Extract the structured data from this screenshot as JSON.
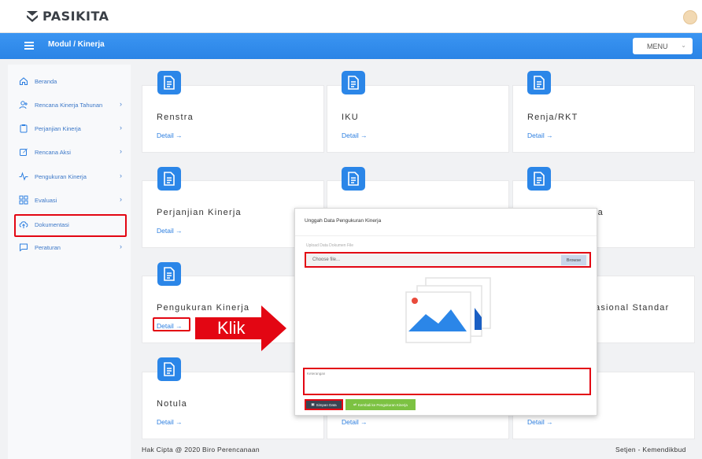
{
  "app": {
    "name": "PASIKITA"
  },
  "header": {
    "breadcrumb": "Modul / Kinerja",
    "menu_label": "MENU"
  },
  "sidebar": {
    "items": [
      {
        "label": "Beranda",
        "icon": "home-icon"
      },
      {
        "label": "Rencana Kinerja Tahunan",
        "icon": "user-plus-icon"
      },
      {
        "label": "Perjanjian Kinerja",
        "icon": "clipboard-icon"
      },
      {
        "label": "Rencana Aksi",
        "icon": "edit-icon"
      },
      {
        "label": "Pengukuran Kinerja",
        "icon": "activity-icon"
      },
      {
        "label": "Evaluasi",
        "icon": "grid-icon"
      },
      {
        "label": "Dokumentasi",
        "icon": "cloud-upload-icon"
      },
      {
        "label": "Peraturan",
        "icon": "message-icon"
      }
    ]
  },
  "cards": [
    {
      "title": "Renstra",
      "detail": "Detail →"
    },
    {
      "title": "IKU",
      "detail": "Detail →"
    },
    {
      "title": "Renja/RKT",
      "detail": "Detail →"
    },
    {
      "title": "Perjanjian Kinerja",
      "detail": "Detail →"
    },
    {
      "title": "",
      "detail": ""
    },
    {
      "title": "ja",
      "detail": ""
    },
    {
      "title": "Pengukuran Kinerja",
      "detail": "Detail →"
    },
    {
      "title": "",
      "detail": ""
    },
    {
      "title": "asional Standar",
      "detail": ""
    },
    {
      "title": "Notula",
      "detail": "Detail →"
    },
    {
      "title": "",
      "detail": "Detail →"
    },
    {
      "title": "",
      "detail": "Detail →"
    }
  ],
  "annotation": {
    "text": "Klik",
    "color": "#e30613"
  },
  "modal": {
    "title": "Unggah Data Pengukuran Kinerja",
    "file_label": "Upload Data Dokumen File",
    "file_placeholder": "Choose file...",
    "browse_label": "Browse",
    "keterangan_placeholder": "Keterangan",
    "save_label": "Simpan Data",
    "back_label": "Kembali ke Pengukuran Kinerja"
  },
  "footer": {
    "left": "Hak Cipta @ 2020 Biro Perencanaan",
    "right": "Setjen - Kemendikbud"
  },
  "colors": {
    "primary": "#2d8cf0",
    "icon_blue": "#2b86e8",
    "highlight": "#e30613",
    "success": "#7cc242"
  }
}
